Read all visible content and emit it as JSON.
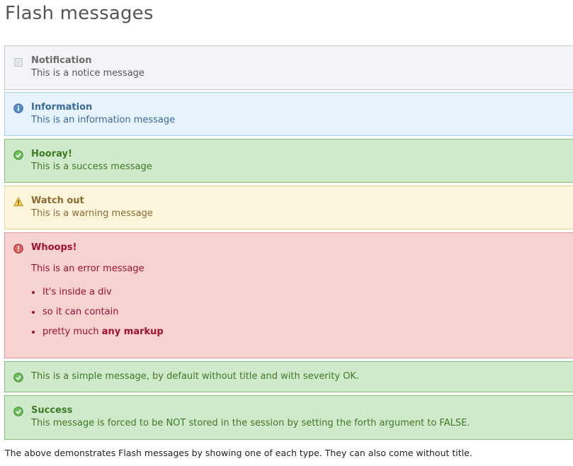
{
  "page": {
    "title": "Flash messages",
    "footer": "The above demonstrates Flash messages by showing one of each type. They can also come without title."
  },
  "messages": {
    "notice": {
      "icon": "notice-document-icon",
      "title": "Notification",
      "body": "This is a notice message",
      "color": "#6a6a6a"
    },
    "info": {
      "icon": "info-icon",
      "title": "Information",
      "body": "This is an information message",
      "color": "#3b6a9a"
    },
    "success": {
      "icon": "checkmark-icon",
      "title": "Hooray!",
      "body": "This is a success message",
      "color": "#3d7a26"
    },
    "warning": {
      "icon": "warning-triangle-icon",
      "title": "Watch out",
      "body": "This is a warning message",
      "color": "#8c6a30"
    },
    "error": {
      "icon": "error-exclamation-icon",
      "title": "Whoops!",
      "body": "This is an error message",
      "color": "#a0112e",
      "list": {
        "item1": "It's inside a div",
        "item2": "so it can contain",
        "item3_prefix": "pretty much ",
        "item3_bold": "any markup"
      }
    },
    "simple": {
      "icon": "checkmark-icon",
      "body": "This is a simple message, by default without title and with severity OK.",
      "color": "#3d7a26"
    },
    "success2": {
      "icon": "checkmark-icon",
      "title": "Success",
      "body": "This message is forced to be NOT stored in the session by setting the forth argument to FALSE.",
      "color": "#3d7a26"
    }
  }
}
